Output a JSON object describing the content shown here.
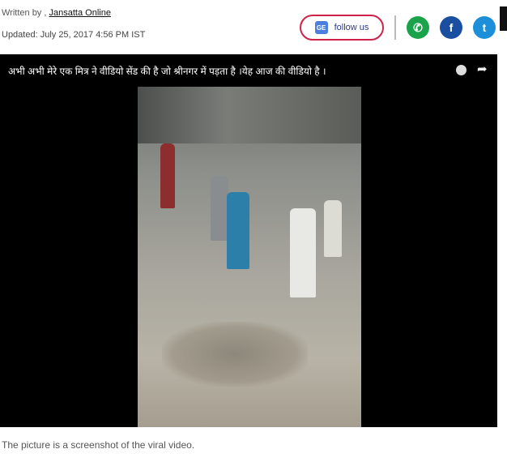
{
  "byline": {
    "prefix": "Written by ,",
    "author": "Jansatta Online"
  },
  "updated": "Updated: July 25, 2017 4:56 PM IST",
  "follow": {
    "label": "follow us",
    "icon": "google-news-icon"
  },
  "share": [
    {
      "name": "whatsapp-icon",
      "glyph": "✆",
      "color": "#1aa34a"
    },
    {
      "name": "facebook-icon",
      "glyph": "f",
      "color": "#1a4ea1"
    },
    {
      "name": "twitter-icon",
      "glyph": "🐦",
      "color": "#1d8fd8"
    }
  ],
  "video": {
    "title": "अभी अभी मेरे एक मित्र ने वीडियो सेंड की है जो श्रीनगर में पड़ता है ।येह आज की वीडियो है ।"
  },
  "caption": "The picture is a screenshot of the viral video."
}
